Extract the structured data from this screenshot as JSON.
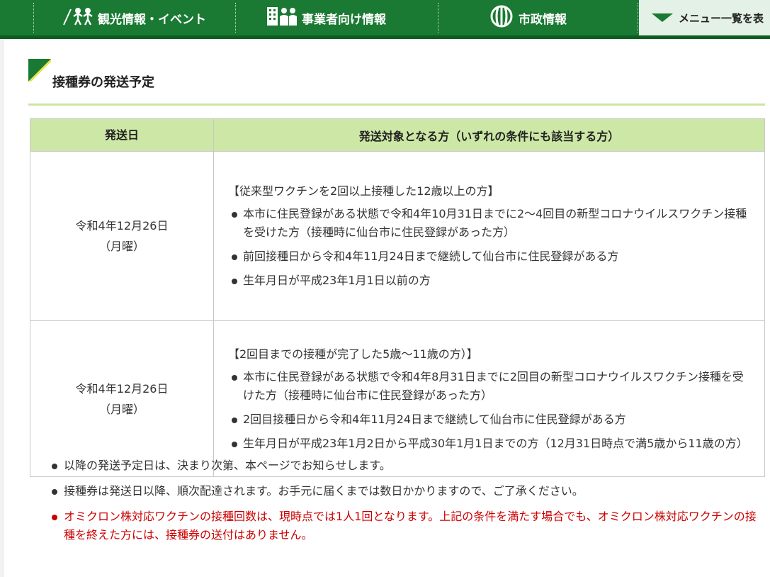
{
  "nav": {
    "tourism_label": "観光情報・イベント",
    "business_label": "事業者向け情報",
    "city_label": "市政情報",
    "menu_label": "メニュー一覧を表"
  },
  "page": {
    "title": "接種券の発送予定"
  },
  "table": {
    "header_date": "発送日",
    "header_target": "発送対象となる方（いずれの条件にも該当する方）",
    "rows": [
      {
        "date": "令和4年12月26日",
        "weekday": "（月曜）",
        "heading": "【従来型ワクチンを2回以上接種した12歳以上の方】",
        "conditions": [
          "本市に住民登録がある状態で令和4年10月31日までに2～4回目の新型コロナウイルスワクチン接種を受けた方（接種時に仙台市に住民登録があった方）",
          "前回接種日から令和4年11月24日まで継続して仙台市に住民登録がある方",
          "生年月日が平成23年1月1日以前の方"
        ]
      },
      {
        "date": "令和4年12月26日",
        "weekday": "（月曜）",
        "heading": "【2回目までの接種が完了した5歳～11歳の方）】",
        "conditions": [
          "本市に住民登録がある状態で令和4年8月31日までに2回目の新型コロナウイルスワクチン接種を受けた方（接種時に仙台市に住民登録があった方）",
          "2回目接種日から令和4年11月24日まで継続して仙台市に住民登録がある方",
          "生年月日が平成23年1月2日から平成30年1月1日までの方（12月31日時点で満5歳から11歳の方）"
        ]
      }
    ]
  },
  "notes": [
    "以降の発送予定日は、決まり次第、本ページでお知らせします。",
    "接種券は発送日以降、順次配達されます。お手元に届くまでは数日かかりますので、ご了承ください。",
    "オミクロン株対応ワクチンの接種回数は、現時点では1人1回となります。上記の条件を満たす場合でも、オミクロン株対応ワクチンの接種を終えた方には、接種券の送付はありません。"
  ],
  "colors": {
    "nav_green": "#1a7a33",
    "table_header": "#cde8a6",
    "warning_red": "#cc0000"
  }
}
